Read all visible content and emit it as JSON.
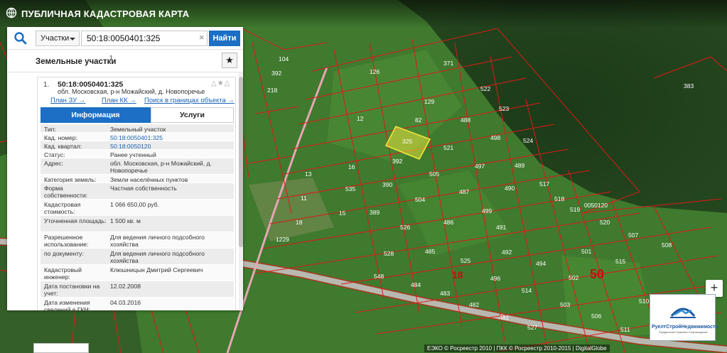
{
  "app": {
    "title": "ПУБЛИЧНАЯ КАДАСТРОВАЯ КАРТА"
  },
  "search": {
    "type": "Участки",
    "value": "50:18:0050401:325",
    "clear": "×",
    "button": "Найти"
  },
  "results": {
    "title": "Земельные участки",
    "count": "1",
    "favorite_icon": "★"
  },
  "item": {
    "index": "1.",
    "cad_number": "50:18:0050401:325",
    "address": "обл. Московская, р-н Можайский, д. Новопоречье",
    "tools": "△★△",
    "links": {
      "plan_zu": "План ЗУ →",
      "plan_kk": "План КК →",
      "search_bounds": "Поиск в границах объекта →"
    },
    "tabs": {
      "info": "Информация",
      "services": "Услуги"
    },
    "rows": [
      {
        "k": "Тип:",
        "v": "Земельный участок"
      },
      {
        "k": "Кад. номер:",
        "v": "50:18:0050401:325",
        "link": true
      },
      {
        "k": "Кад. квартал:",
        "v": "50:18:0050120",
        "link": true
      },
      {
        "k": "Статус:",
        "v": "Ранее учтенный"
      },
      {
        "k": "Адрес:",
        "v": "обл. Московская, р-н Можайский, д. Новопоречье"
      },
      {
        "k": "Категория земель:",
        "v": "Земли населённых пунктов"
      },
      {
        "k": "Форма собственности:",
        "v": "Частная собственность"
      },
      {
        "k": "Кадастровая стоимость:",
        "v": "1 066 650,00 руб."
      },
      {
        "k": "Уточненная площадь:",
        "v": "1 500 кв. м"
      },
      {
        "k": "Разрешенное использование:",
        "v": "Для ведения личного подсобного хозяйства"
      },
      {
        "k": "по документу:",
        "v": "Для ведения личного подсобного хозяйства"
      },
      {
        "k": "Кадастровый инженер:",
        "v": "Клюшницын Дмитрий Сергеевич"
      },
      {
        "k": "Дата постановки на учет:",
        "v": "12.02.2008"
      },
      {
        "k": "Дата изменения сведений в ГКН:",
        "v": "04.03.2016"
      }
    ]
  },
  "map": {
    "selected_parcel": "325",
    "quarter_label": "0050120",
    "big_labels": [
      "18",
      "50"
    ],
    "parcel_labels": [
      "104",
      "392",
      "218",
      "126",
      "371",
      "522",
      "383",
      "129",
      "523",
      "82",
      "488",
      "498",
      "524",
      "12",
      "325",
      "521",
      "16",
      "392",
      "497",
      "489",
      "505",
      "487",
      "490",
      "517",
      "518",
      "390",
      "504",
      "499",
      "519",
      "520",
      "389",
      "486",
      "491",
      "507",
      "526",
      "508",
      "485",
      "492",
      "501",
      "528",
      "525",
      "494",
      "515",
      "484",
      "496",
      "502",
      "483",
      "514",
      "503",
      "482",
      "506",
      "481",
      "527",
      "511",
      "510",
      "1229",
      "548",
      "13",
      "11",
      "18",
      "15",
      "535"
    ],
    "colors": {
      "parcel_border": "#e01818",
      "selected_fill": "#e8e23a",
      "accent": "#1c6fc4"
    }
  },
  "brand": {
    "name": "РуелтСтройНедвижимость",
    "tagline": "Юридическое Правовое Сопровождение"
  },
  "attribution": "ЕЭКО © Росреестр 2010 | ПКК © Росреестр 2010-2015 | DigitalGlobe",
  "zoom": {
    "in": "+"
  }
}
